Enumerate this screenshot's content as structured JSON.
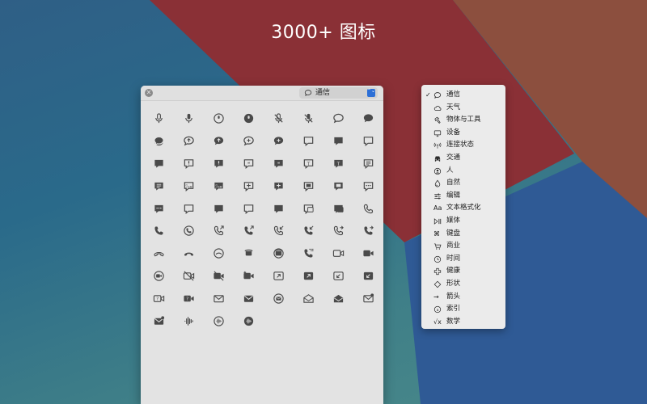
{
  "headline": "3000+ 图标",
  "picker": {
    "close_glyph": "✕",
    "selected_category": "通信",
    "select_arrows": "⌃⌄",
    "icons": [
      "mic-icon",
      "mic-fill-icon",
      "mic-circle-icon",
      "mic-circle-fill-icon",
      "mic-slash-icon",
      "mic-slash-fill-icon",
      "bubble-left-icon",
      "bubble-left-fill-icon",
      "bubble-circle-fill-icon",
      "bubble-arrow-up-icon",
      "bubble-arrow-up-fill-icon",
      "bubble-plus-icon",
      "bubble-plus-fill-icon",
      "bubble-rect-icon",
      "bubble-rect-fill-icon",
      "bubble-rect-right-icon",
      "bubble-rect-fill-2-icon",
      "bubble-exclamation-icon",
      "bubble-exclamation-fill-icon",
      "bubble-quote-icon",
      "bubble-quote-fill-icon",
      "bubble-t-icon",
      "bubble-t-fill-icon",
      "bubble-text-icon",
      "bubble-text-fill-icon",
      "bubble-dots-cursive-icon",
      "bubble-cursive-fill-icon",
      "bubble-plus-2-icon",
      "bubble-plus-2-fill-icon",
      "bubble-image-icon",
      "bubble-image-fill-icon",
      "bubble-ellipsis-icon",
      "bubble-ellipsis-fill-icon",
      "bubble-middle-icon",
      "bubble-middle-fill-icon",
      "bubble-bottom-icon",
      "bubble-bottom-fill-icon",
      "bubbles-two-icon",
      "bubbles-two-fill-icon",
      "phone-icon",
      "phone-fill-icon",
      "phone-circle-icon",
      "phone-arrow-up-right-icon",
      "phone-arrow-up-right-fill-icon",
      "phone-arrow-down-left-icon",
      "phone-arrow-down-left-fill-icon",
      "phone-arrow-right-icon",
      "phone-arrow-right-fill-icon",
      "phone-down-icon",
      "phone-down-fill-icon",
      "phone-down-circle-icon",
      "teletype-icon",
      "teletype-circle-icon",
      "keypad-phone-icon",
      "video-icon",
      "video-fill-icon",
      "video-circle-icon",
      "video-slash-icon",
      "video-slash-fill-icon",
      "video-badge-plus-icon",
      "arrow-up-right-video-icon",
      "arrow-up-right-video-fill-icon",
      "arrow-down-left-video-icon",
      "arrow-down-left-video-fill-icon",
      "questionmark-video-icon",
      "questionmark-video-fill-icon",
      "envelope-icon",
      "envelope-fill-icon",
      "envelope-circle-icon",
      "envelope-open-icon",
      "envelope-open-fill-icon",
      "envelope-badge-icon",
      "envelope-badge-fill-icon",
      "waveform-icon",
      "waveform-circle-icon",
      "waveform-circle-fill-icon"
    ]
  },
  "menu": {
    "items": [
      {
        "label": "通信",
        "icon": "bubble-icon",
        "checked": true
      },
      {
        "label": "天气",
        "icon": "cloud-icon"
      },
      {
        "label": "物体与工具",
        "icon": "hammer-icon"
      },
      {
        "label": "设备",
        "icon": "display-icon"
      },
      {
        "label": "连接状态",
        "icon": "antenna-icon"
      },
      {
        "label": "交通",
        "icon": "car-icon"
      },
      {
        "label": "人",
        "icon": "person-circle-icon"
      },
      {
        "label": "自然",
        "icon": "drop-icon"
      },
      {
        "label": "编辑",
        "icon": "slider-icon"
      },
      {
        "label": "文本格式化",
        "icon": "textformat-icon",
        "glyph": "Aa"
      },
      {
        "label": "媒体",
        "icon": "play-pause-icon"
      },
      {
        "label": "键盘",
        "icon": "command-icon",
        "glyph": "⌘"
      },
      {
        "label": "商业",
        "icon": "cart-icon"
      },
      {
        "label": "时间",
        "icon": "clock-icon"
      },
      {
        "label": "健康",
        "icon": "cross-icon"
      },
      {
        "label": "形状",
        "icon": "diamond-icon"
      },
      {
        "label": "箭头",
        "icon": "arrow-right-icon",
        "glyph": "→"
      },
      {
        "label": "索引",
        "icon": "a-circle-icon"
      },
      {
        "label": "数学",
        "icon": "sqrt-icon",
        "glyph": "√x"
      }
    ]
  }
}
